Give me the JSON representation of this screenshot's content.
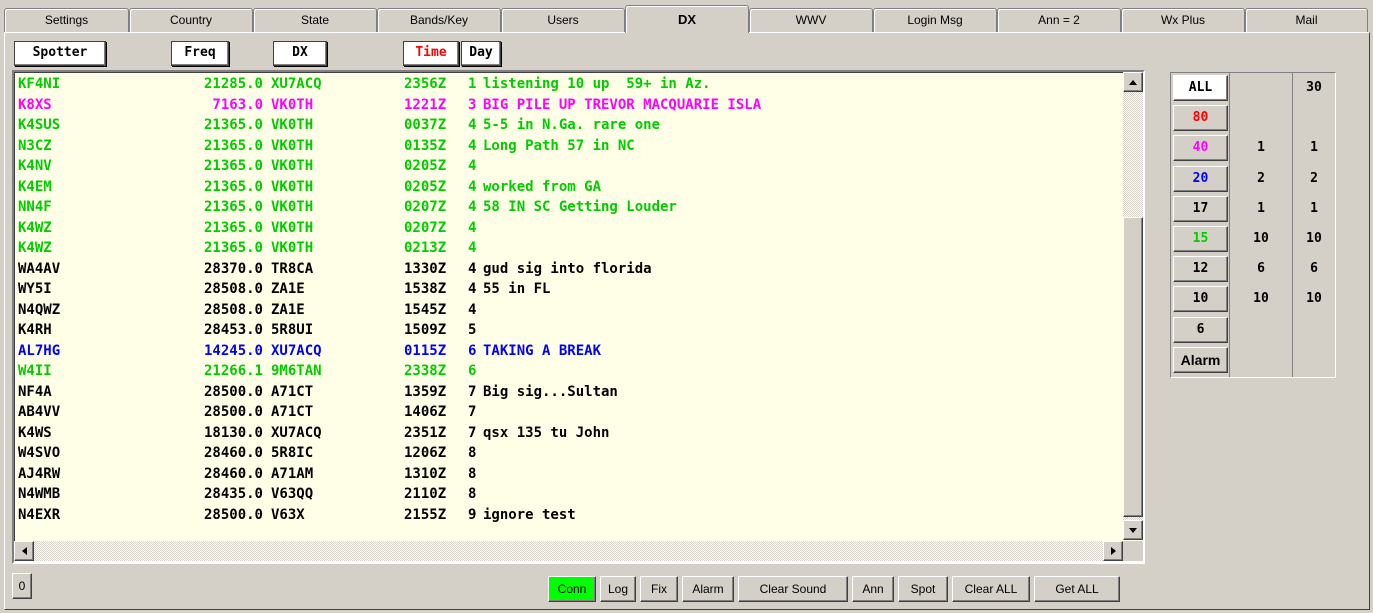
{
  "tabs": [
    "Settings",
    "Country",
    "State",
    "Bands/Key",
    "Users",
    "DX",
    "WWV",
    "Login Msg",
    "Ann = 2",
    "Wx Plus",
    "Mail"
  ],
  "active_tab": "DX",
  "columns": {
    "spotter": "Spotter",
    "freq": "Freq",
    "dx": "DX",
    "time": "Time",
    "day": "Day"
  },
  "colors": {
    "green": "#00cc00",
    "magenta": "#ff00ff",
    "black": "#000000",
    "blue": "#0000ff",
    "red": "#ff0000",
    "listbg": "#ffffe7",
    "conn": "#00ff00"
  },
  "spots": [
    {
      "call": "KF4NI",
      "freq": "21285.0",
      "dx": "XU7ACQ",
      "time": "2356Z",
      "day": "1",
      "comment": "listening 10 up  59+ in Az.",
      "color": "green"
    },
    {
      "call": "K8XS",
      "freq": "7163.0",
      "dx": "VK0TH",
      "time": "1221Z",
      "day": "3",
      "comment": "BIG PILE UP TREVOR MACQUARIE ISLA",
      "color": "magenta"
    },
    {
      "call": "K4SUS",
      "freq": "21365.0",
      "dx": "VK0TH",
      "time": "0037Z",
      "day": "4",
      "comment": "5-5 in N.Ga. rare one",
      "color": "green"
    },
    {
      "call": "N3CZ",
      "freq": "21365.0",
      "dx": "VK0TH",
      "time": "0135Z",
      "day": "4",
      "comment": "Long Path 57 in NC",
      "color": "green"
    },
    {
      "call": "K4NV",
      "freq": "21365.0",
      "dx": "VK0TH",
      "time": "0205Z",
      "day": "4",
      "comment": "",
      "color": "green"
    },
    {
      "call": "K4EM",
      "freq": "21365.0",
      "dx": "VK0TH",
      "time": "0205Z",
      "day": "4",
      "comment": "worked from GA",
      "color": "green"
    },
    {
      "call": "NN4F",
      "freq": "21365.0",
      "dx": "VK0TH",
      "time": "0207Z",
      "day": "4",
      "comment": "58 IN SC Getting Louder",
      "color": "green"
    },
    {
      "call": "K4WZ",
      "freq": "21365.0",
      "dx": "VK0TH",
      "time": "0207Z",
      "day": "4",
      "comment": "",
      "color": "green"
    },
    {
      "call": "K4WZ",
      "freq": "21365.0",
      "dx": "VK0TH",
      "time": "0213Z",
      "day": "4",
      "comment": "",
      "color": "green"
    },
    {
      "call": "WA4AV",
      "freq": "28370.0",
      "dx": "TR8CA",
      "time": "1330Z",
      "day": "4",
      "comment": "gud sig into florida",
      "color": "black"
    },
    {
      "call": "WY5I",
      "freq": "28508.0",
      "dx": "ZA1E",
      "time": "1538Z",
      "day": "4",
      "comment": "55 in FL",
      "color": "black"
    },
    {
      "call": "N4QWZ",
      "freq": "28508.0",
      "dx": "ZA1E",
      "time": "1545Z",
      "day": "4",
      "comment": "",
      "color": "black"
    },
    {
      "call": "K4RH",
      "freq": "28453.0",
      "dx": "5R8UI",
      "time": "1509Z",
      "day": "5",
      "comment": "",
      "color": "black"
    },
    {
      "call": "AL7HG",
      "freq": "14245.0",
      "dx": "XU7ACQ",
      "time": "0115Z",
      "day": "6",
      "comment": "TAKING A BREAK",
      "color": "blue"
    },
    {
      "call": "W4II",
      "freq": "21266.1",
      "dx": "9M6TAN",
      "time": "2338Z",
      "day": "6",
      "comment": "",
      "color": "green"
    },
    {
      "call": "NF4A",
      "freq": "28500.0",
      "dx": "A71CT",
      "time": "1359Z",
      "day": "7",
      "comment": "Big sig...Sultan",
      "color": "black"
    },
    {
      "call": "AB4VV",
      "freq": "28500.0",
      "dx": "A71CT",
      "time": "1406Z",
      "day": "7",
      "comment": "",
      "color": "black"
    },
    {
      "call": "K4WS",
      "freq": "18130.0",
      "dx": "XU7ACQ",
      "time": "2351Z",
      "day": "7",
      "comment": "qsx 135 tu John",
      "color": "black"
    },
    {
      "call": "W4SVO",
      "freq": "28460.0",
      "dx": "5R8IC",
      "time": "1206Z",
      "day": "8",
      "comment": "",
      "color": "black"
    },
    {
      "call": "AJ4RW",
      "freq": "28460.0",
      "dx": "A71AM",
      "time": "1310Z",
      "day": "8",
      "comment": "",
      "color": "black"
    },
    {
      "call": "N4WMB",
      "freq": "28435.0",
      "dx": "V63QQ",
      "time": "2110Z",
      "day": "8",
      "comment": "",
      "color": "black"
    },
    {
      "call": "N4EXR",
      "freq": "28500.0",
      "dx": "V63X",
      "time": "2155Z",
      "day": "9",
      "comment": "ignore test",
      "color": "black"
    }
  ],
  "bands": [
    {
      "label": "ALL",
      "color": "#000000",
      "count1": "",
      "count2": "30"
    },
    {
      "label": "80",
      "color": "#ff0000",
      "count1": "",
      "count2": ""
    },
    {
      "label": "40",
      "color": "#ff00ff",
      "count1": "1",
      "count2": "1"
    },
    {
      "label": "20",
      "color": "#0000ff",
      "count1": "2",
      "count2": "2"
    },
    {
      "label": "17",
      "color": "#000000",
      "count1": "1",
      "count2": "1"
    },
    {
      "label": "15",
      "color": "#00cc00",
      "count1": "10",
      "count2": "10"
    },
    {
      "label": "12",
      "color": "#000000",
      "count1": "6",
      "count2": "6"
    },
    {
      "label": "10",
      "color": "#000000",
      "count1": "10",
      "count2": "10"
    },
    {
      "label": "6",
      "color": "#000000",
      "count1": "",
      "count2": ""
    },
    {
      "label": "Alarm",
      "color": "#000000",
      "count1": "",
      "count2": ""
    }
  ],
  "zero_button": "0",
  "bottom_buttons": [
    "Conn",
    "Log",
    "Fix",
    "Alarm",
    "Clear Sound",
    "Ann",
    "Spot",
    "Clear ALL",
    "Get ALL"
  ]
}
